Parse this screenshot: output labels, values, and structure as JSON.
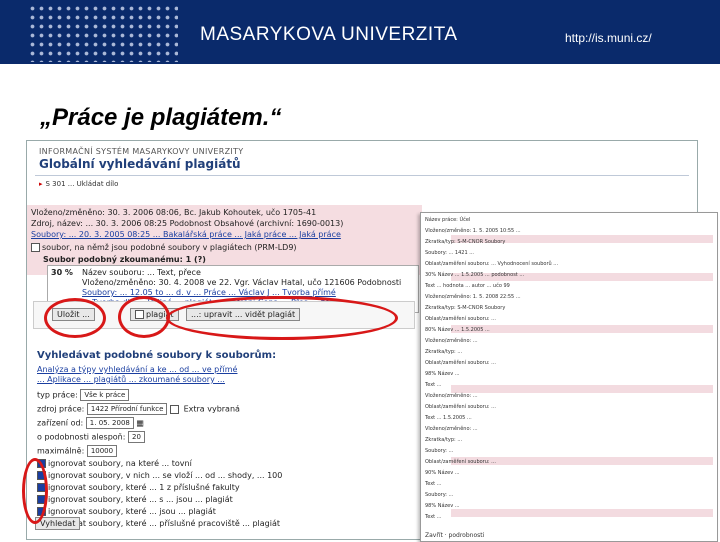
{
  "banner": {
    "university": "MASARYKOVA UNIVERZITA",
    "url": "http://is.muni.cz/",
    "colors": {
      "banner_bg": "#0a2a6b",
      "annotation": "#d81818",
      "link": "#1a3ea0"
    }
  },
  "slide_title": "„Práce je plagiátem.“",
  "screenshot": {
    "system_name": "INFORMAČNÍ SYSTÉM MASARYKOVY UNIVERZITY",
    "app_title": "Globální vyhledávání plagiátů",
    "breadcrumb": "S 301 ... Ukládat dílo",
    "record_lines": [
      "Vloženo/změněno: 30. 3. 2006 08:06, Bc. Jakub Kohoutek, učo 1705-41",
      "Zdroj, název: ... 30. 3. 2006 08:25  Podobnost  Obsahové  (archivní: 1690-0013)",
      "Soubory: ... 20. 3. 2005 08:25 ...  Bakalářská práce  ... Jaká práce  ... Jaká práce",
      "soubor, na němž jsou podobné soubory v plagiátech (PRM-LD9)",
      "Soubor podobný zkoumanému: 1 (?)"
    ],
    "result": {
      "percent": "30 %",
      "lines": [
        "Název souboru: ... Text, přece",
        "Vloženo/změněno: 30. 4. 2008 ve 22. Vgr. Václav Hatal, učo 121606 Podobnosti",
        "Soubory: ... 12.05 to ... d. v ... Práce  ... Václav J ... Tvorba přímé",
        "... Tvorba dle ... Jediné ... plagiát ... Udělení Cena ... Přes ... ženy"
      ]
    },
    "buttons": {
      "submit": "Uložit ...",
      "plagiarism": "plagiát",
      "action": "...: upravit ... vidět plagiát"
    },
    "search_section": {
      "title": "Vyhledávat podobné soubory k souborům:",
      "hint_lines": [
        "Analýza a týpy vyhledávání a ke ... od ... ve přímé",
        "... Aplikace ... plagiátů ... zkoumané soubory ..."
      ],
      "fields": {
        "type_label": "typ práce:",
        "type_value": "Vše k práce",
        "id_label": "zdroj práce:",
        "id_value": "1422 Přírodní funkce",
        "date_label": "zařízení od:",
        "date_value": "1. 05. 2008",
        "limit_label": "o podobnosti alespoň:",
        "limit_value": "20",
        "max_label": "maximálně:",
        "max_value": "10000",
        "checkbox_label": "Extra vybraná"
      },
      "options": [
        "ignorovat soubory, na které ... tovní",
        "ignorovat soubory, v nich ... se vloží ... od ... shody, ... 100",
        "ignorovat soubory, které ... 1 z příslušné fakulty",
        "ignorovat soubory, které ... s ... jsou ... plagiát",
        "ignorovat soubory, které ... jsou ... plagiát",
        "ignorovat soubory, které ... příslušné pracoviště ... plagiát"
      ],
      "submit": "Vyhledat"
    }
  },
  "overlay": {
    "rows": [
      "Název práce:  Účel",
      "Vloženo/změněno: 1. 5. 2005 10:55 ...",
      "Zkratka/typ:  S-M-CNOR  Soubory",
      "Soubory: ... 1421 ...",
      "Oblast/zaměření souboru: ... Vyhodnocení souborů ...",
      "30%  Název ... 1.5.2005 ... podobnost ...",
      "Text ... hodnota ... autor ... učo 99",
      "Vloženo/změněno: 1. 5. 2008 22:55 ...",
      "Zkratka/typ:  S-M-CNOR  Soubory",
      "Oblast/zaměření souboru: ...",
      "80%  Název ... 1.5.2005 ...",
      "Vloženo/změněno: ...",
      "Zkratka/typ: ...",
      "Oblast/zaměření souboru: ...",
      "98%  Název ... ",
      "Text ...",
      "Vloženo/změněno: ...",
      "Oblast/zaměření souboru: ...",
      "Text ... 1.5.2005 ...",
      "Vloženo/změněno: ...",
      "Zkratka/typ: ...",
      "Soubory: ...",
      "Oblast/zaměření souboru: ...",
      "90%  Název ...",
      "Text ...",
      "Soubory: ...",
      "98%  Název ...",
      "Text ..."
    ],
    "footer": "Zavřít · podrobnosti"
  }
}
